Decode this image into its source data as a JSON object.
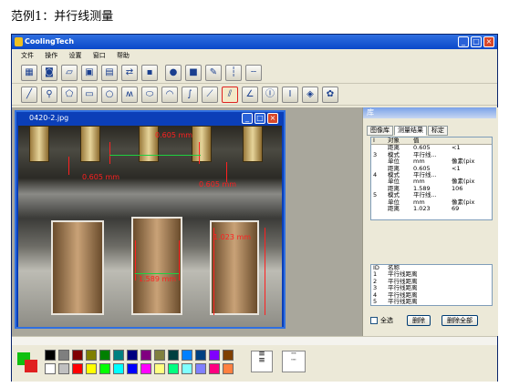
{
  "caption": "范例1：并行线测量",
  "app": {
    "title": "CoolingTech",
    "menu": [
      "文件",
      "操作",
      "设置",
      "窗口",
      "帮助"
    ]
  },
  "toolbar1_icons": [
    "grid-icon",
    "camera-icon",
    "folder-open-icon",
    "image-icon",
    "document-icon",
    "swap-icon",
    "save-icon",
    "record-icon",
    "stop-icon",
    "wrench-icon",
    "ruler-vertical-icon",
    "ruler-horizontal-icon"
  ],
  "toolbar2_icons": [
    "line-icon",
    "zoom-icon",
    "polygon-icon",
    "rectangle-icon",
    "circle-icon",
    "polyline-icon",
    "ellipse-icon",
    "arc-icon",
    "curve-icon",
    "slash-icon",
    "parallel-lines-icon",
    "angle-icon",
    "i-beam-icon",
    "i-box-icon",
    "diamond-icon",
    "palette-icon"
  ],
  "image_window": {
    "title": "0420-2.jpg",
    "measurements": [
      "0.605 mm",
      "0.605 mm",
      "0.605 mm",
      "1.023 mm",
      "1.589 mm"
    ]
  },
  "right_panel": {
    "title": "库",
    "tabs": [
      "图像库",
      "测量结果",
      "标定"
    ],
    "active_tab": 1,
    "table_headers": [
      "I",
      "对象",
      "值"
    ],
    "rows": [
      [
        "",
        "距离",
        "0.605",
        "<1"
      ],
      [
        "3",
        "模式",
        "平行线...",
        ""
      ],
      [
        "",
        "单位",
        "mm",
        "像素(pix"
      ],
      [
        "",
        "距离",
        "0.605",
        "<1"
      ],
      [
        "4",
        "模式",
        "平行线...",
        ""
      ],
      [
        "",
        "单位",
        "mm",
        "像素(pix"
      ],
      [
        "",
        "距离",
        "1.589",
        "106"
      ],
      [
        "5",
        "模式",
        "平行线...",
        ""
      ],
      [
        "",
        "单位",
        "mm",
        "像素(pix"
      ],
      [
        "",
        "距离",
        "1.023",
        "69"
      ]
    ],
    "list_headers": [
      "ID",
      "名称"
    ],
    "list": [
      [
        "1",
        "平行线距离"
      ],
      [
        "2",
        "平行线距离"
      ],
      [
        "3",
        "平行线距离"
      ],
      [
        "4",
        "平行线距离"
      ],
      [
        "5",
        "平行线距离"
      ]
    ],
    "select_all": "全选",
    "delete": "删除",
    "delete_all": "删除全部"
  },
  "palette": {
    "current_fg": "#10c010",
    "current_bg": "#e02020",
    "colors": [
      "#000000",
      "#7f7f7f",
      "#800000",
      "#808000",
      "#008000",
      "#008080",
      "#000080",
      "#800080",
      "#808040",
      "#004040",
      "#0080ff",
      "#004080",
      "#8000ff",
      "#804000",
      "#ffffff",
      "#c0c0c0",
      "#ff0000",
      "#ffff00",
      "#00ff00",
      "#00ffff",
      "#0000ff",
      "#ff00ff",
      "#ffff80",
      "#00ff80",
      "#80ffff",
      "#8080ff",
      "#ff0080",
      "#ff8040"
    ]
  }
}
